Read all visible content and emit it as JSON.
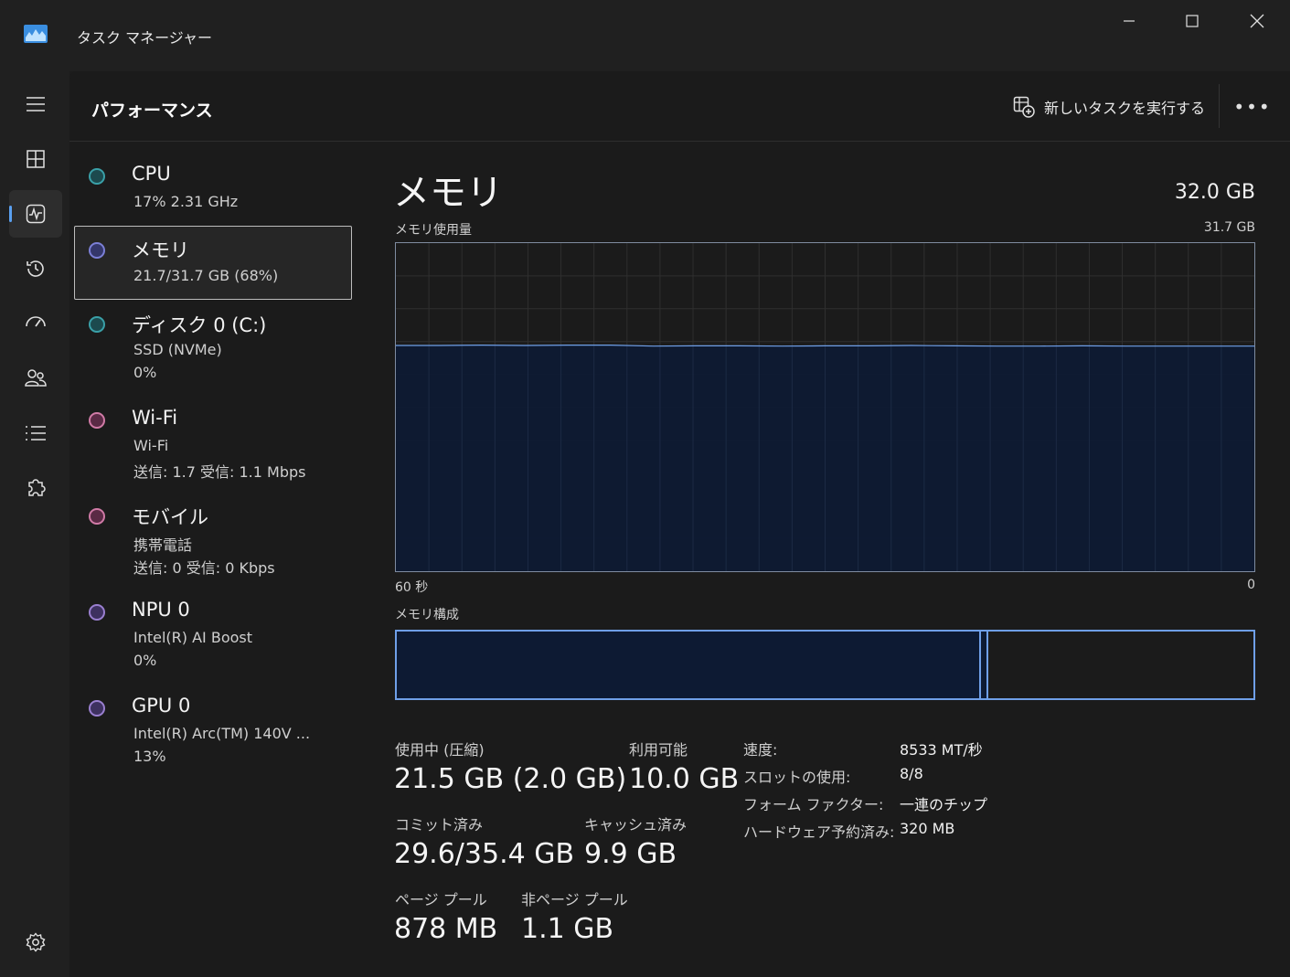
{
  "window": {
    "title": "タスク マネージャー",
    "minimize_label": "—",
    "maximize_label": "☐",
    "close_label": "✕"
  },
  "header": {
    "title": "パフォーマンス",
    "run_task_label": "新しいタスクを実行する",
    "more_label": "•••"
  },
  "nav": {
    "items": [
      {
        "name": "hamburger-menu",
        "icon": "menu-icon"
      },
      {
        "name": "processes",
        "icon": "grid-icon"
      },
      {
        "name": "performance",
        "icon": "performance-icon",
        "active": true
      },
      {
        "name": "app-history",
        "icon": "history-icon"
      },
      {
        "name": "startup-apps",
        "icon": "startup-icon"
      },
      {
        "name": "users",
        "icon": "users-icon"
      },
      {
        "name": "details",
        "icon": "list-icon"
      },
      {
        "name": "services",
        "icon": "puzzle-icon"
      },
      {
        "name": "settings",
        "icon": "gear-icon"
      }
    ]
  },
  "devices": [
    {
      "title": "CPU",
      "sub1": "17%  2.31 GHz",
      "sub2": "",
      "color": "#3aa0a8"
    },
    {
      "title": "メモリ",
      "sub1": "21.7/31.7 GB (68%)",
      "sub2": "",
      "color": "#7b7fd6",
      "selected": true
    },
    {
      "title": "ディスク 0 (C:)",
      "sub1": "SSD (NVMe)",
      "sub2": "0%",
      "color": "#3aa0a8"
    },
    {
      "title": "Wi-Fi",
      "sub1": "Wi-Fi",
      "sub2": "送信: 1.7  受信: 1.1 Mbps",
      "color": "#d07aa6"
    },
    {
      "title": "モバイル",
      "sub1": "携帯電話",
      "sub2": "送信: 0  受信: 0 Kbps",
      "color": "#d07aa6"
    },
    {
      "title": "NPU 0",
      "sub1": "Intel(R) AI Boost",
      "sub2": "0%",
      "color": "#9a7fd0"
    },
    {
      "title": "GPU 0",
      "sub1": "Intel(R) Arc(TM) 140V ...",
      "sub2": "13%",
      "color": "#9a7fd0"
    }
  ],
  "memory": {
    "title": "メモリ",
    "total": "32.0 GB",
    "usage_label": "メモリ使用量",
    "usage_max": "31.7 GB",
    "axis_left": "60 秒",
    "axis_right": "0",
    "composition_label": "メモリ構成",
    "accent_color": "#6f9fe8",
    "fill_color": "#0d1a33",
    "usage_series": [
      0.688,
      0.688,
      0.689,
      0.688,
      0.689,
      0.689,
      0.686,
      0.687,
      0.687,
      0.686,
      0.687,
      0.687,
      0.688,
      0.687,
      0.686,
      0.686,
      0.687,
      0.686,
      0.686,
      0.686,
      0.686
    ],
    "composition": {
      "in_use_fraction": 0.68,
      "modified_fraction": 0.006
    }
  },
  "stats": {
    "in_use_label": "使用中 (圧縮)",
    "in_use_value": "21.5 GB (2.0 GB)",
    "available_label": "利用可能",
    "available_value": "10.0 GB",
    "committed_label": "コミット済み",
    "committed_value": "29.6/35.4 GB",
    "cached_label": "キャッシュ済み",
    "cached_value": "9.9 GB",
    "paged_pool_label": "ページ プール",
    "paged_pool_value": "878 MB",
    "nonpaged_pool_label": "非ページ プール",
    "nonpaged_pool_value": "1.1 GB"
  },
  "details": [
    {
      "key": "速度:",
      "value": "8533 MT/秒"
    },
    {
      "key": "スロットの使用:",
      "value": "8/8"
    },
    {
      "key": "フォーム ファクター:",
      "value": "一連のチップ"
    },
    {
      "key": "ハードウェア予約済み:",
      "value": "320 MB"
    }
  ]
}
